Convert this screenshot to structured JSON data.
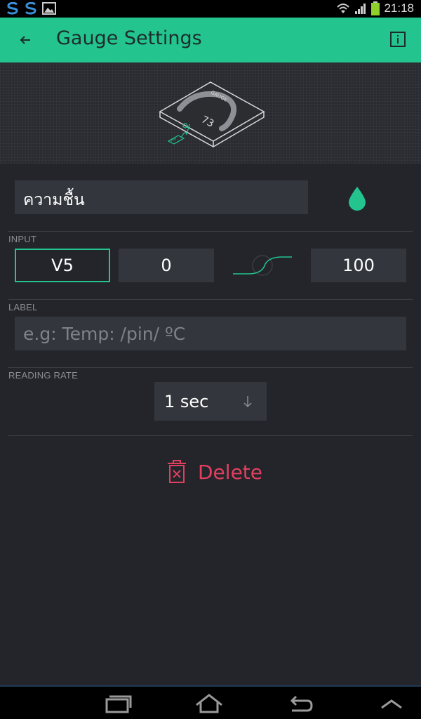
{
  "status_bar": {
    "time": "21:18",
    "left_icons": [
      "ss-notification-icon",
      "ss-notification-icon",
      "image-notification-icon"
    ],
    "right_icons": [
      "wifi-icon",
      "signal-icon",
      "battery-icon"
    ]
  },
  "app_bar": {
    "title": "Gauge Settings",
    "back_icon": "arrow-left-icon",
    "info_icon": "info-icon"
  },
  "preview": {
    "widget_label": "GAUGE",
    "widget_value": "73",
    "pin_tag": "PIN"
  },
  "widget_name": {
    "value": "ความชื้น",
    "color_icon": "droplet-icon",
    "color": "#23c48e"
  },
  "input_section": {
    "heading": "INPUT",
    "pin": "V5",
    "min": "0",
    "max": "100",
    "mapping_icon": "mapping-curve-icon"
  },
  "label_section": {
    "heading": "LABEL",
    "placeholder": "e.g: Temp: /pin/ ºC",
    "value": ""
  },
  "reading_rate": {
    "heading": "READING RATE",
    "selected": "1 sec",
    "dropdown_icon": "arrow-down-icon"
  },
  "delete": {
    "label": "Delete",
    "icon": "trash-icon",
    "color": "#e0405e"
  },
  "nav_bar": {
    "icons": [
      "recent-apps-icon",
      "home-icon",
      "back-icon",
      "chevron-up-icon"
    ]
  },
  "colors": {
    "accent": "#23c48e",
    "background": "#23252b",
    "field": "#33363c",
    "danger": "#e0405e"
  }
}
